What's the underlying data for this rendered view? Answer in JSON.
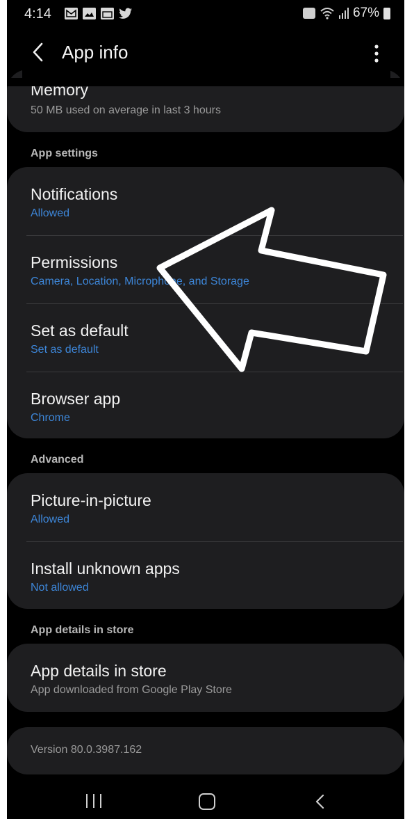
{
  "status_bar": {
    "time": "4:14",
    "battery": "67%",
    "left_icons": [
      "gmail-icon",
      "gallery-icon",
      "calendar-icon",
      "twitter-icon"
    ],
    "right_icons": [
      "alarm-icon",
      "wifi-icon",
      "signal-icon",
      "battery-icon"
    ]
  },
  "header": {
    "title": "App info",
    "back_icon": "back-arrow-icon",
    "more_icon": "more-vert-icon"
  },
  "memory": {
    "title": "Memory",
    "subtitle": "50 MB used on average in last 3 hours"
  },
  "sections": {
    "app_settings": "App settings",
    "advanced": "Advanced",
    "store": "App details in store"
  },
  "app_settings": [
    {
      "title": "Notifications",
      "subtitle": "Allowed"
    },
    {
      "title": "Permissions",
      "subtitle": "Camera, Location, Microphone, and Storage"
    },
    {
      "title": "Set as default",
      "subtitle": "Set as default"
    },
    {
      "title": "Browser app",
      "subtitle": "Chrome"
    }
  ],
  "advanced": [
    {
      "title": "Picture-in-picture",
      "subtitle": "Allowed"
    },
    {
      "title": "Install unknown apps",
      "subtitle": "Not allowed"
    }
  ],
  "store": {
    "title": "App details in store",
    "subtitle": "App downloaded from Google Play Store"
  },
  "version": "Version 80.0.3987.162",
  "colors": {
    "background": "#000000",
    "card": "#1e1e20",
    "accent": "#3d86d8",
    "text_primary": "#f2f2f2",
    "text_secondary": "#9a9a9a"
  },
  "annotation": "arrow-pointer-icon",
  "nav_icons": [
    "recent-apps-icon",
    "home-icon",
    "back-nav-icon"
  ]
}
